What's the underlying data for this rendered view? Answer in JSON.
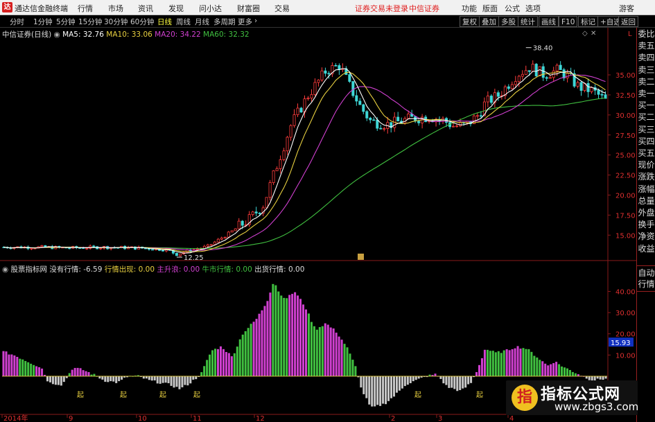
{
  "titlebar": {
    "app_name": "通达信金融终端",
    "menu": [
      "行情",
      "市场",
      "资讯",
      "发现",
      "问小达",
      "财富圈",
      "交易"
    ],
    "login_status": "证券交易未登录",
    "broker": "中信证券",
    "right_menu": [
      "功能",
      "版面",
      "公式",
      "选项"
    ],
    "guest": "游客"
  },
  "periods": [
    "分时",
    "1分钟",
    "5分钟",
    "15分钟",
    "30分钟",
    "60分钟",
    "日线",
    "周线",
    "月线",
    "多周期",
    "更多"
  ],
  "active_period": "日线",
  "toolbar": [
    "复权",
    "叠加",
    "多股",
    "统计",
    "画线",
    "F10",
    "标记",
    "+自选",
    "返回"
  ],
  "main_chart": {
    "stock": "中信证券(日线)",
    "ma5_label": "MA5: 32.76",
    "ma10_label": "MA10: 33.06",
    "ma20_label": "MA20: 34.22",
    "ma60_label": "MA60: 32.32",
    "high_annotation": "38.40",
    "low_annotation": "12.25",
    "corner_L": "L",
    "colors": {
      "up": "#ff3c3c",
      "down": "#3fd7d7",
      "ma5": "#ffffff",
      "ma10": "#e8d040",
      "ma20": "#d040d0",
      "ma60": "#40c040"
    }
  },
  "sub_chart": {
    "indicator": "股票指标网",
    "no_market_label": "没有行情:",
    "no_market_value": "-6.59",
    "market_label": "行情出现:",
    "market_value": "0.00",
    "main_rise_label": "主升浪:",
    "main_rise_value": "0.00",
    "bull_label": "牛市行情:",
    "bull_value": "0.00",
    "exit_label": "出货行情:",
    "exit_value": "0.00",
    "current_value_badge": "15.93",
    "signal_text": "起"
  },
  "chart_data": [
    {
      "type": "candlestick",
      "y_ticks": [
        "35.00",
        "32.50",
        "30.00",
        "27.50",
        "25.00",
        "22.50",
        "20.00",
        "17.50",
        "15.00"
      ],
      "ylim": [
        12.0,
        39.5
      ],
      "series_names": [
        "MA5",
        "MA10",
        "MA20",
        "MA60"
      ]
    },
    {
      "type": "bar",
      "y_ticks": [
        "40.00",
        "30.00",
        "20.00",
        "10.00"
      ],
      "ylim": [
        -17,
        48
      ]
    }
  ],
  "x_axis": [
    "2014年",
    "9",
    "10",
    "11",
    "12",
    "2",
    "3",
    "4"
  ],
  "right_panel": [
    "委比",
    "卖五",
    "卖四",
    "卖三",
    "卖二",
    "卖一",
    "买一",
    "买二",
    "买三",
    "买四",
    "买五",
    "现价",
    "涨跌",
    "涨幅",
    "总量",
    "外盘",
    "换手",
    "净资",
    "收益"
  ],
  "auto_button": [
    "自动",
    "行情"
  ],
  "watermark": {
    "title": "指标公式网",
    "url": "www.zbgs3.com"
  }
}
